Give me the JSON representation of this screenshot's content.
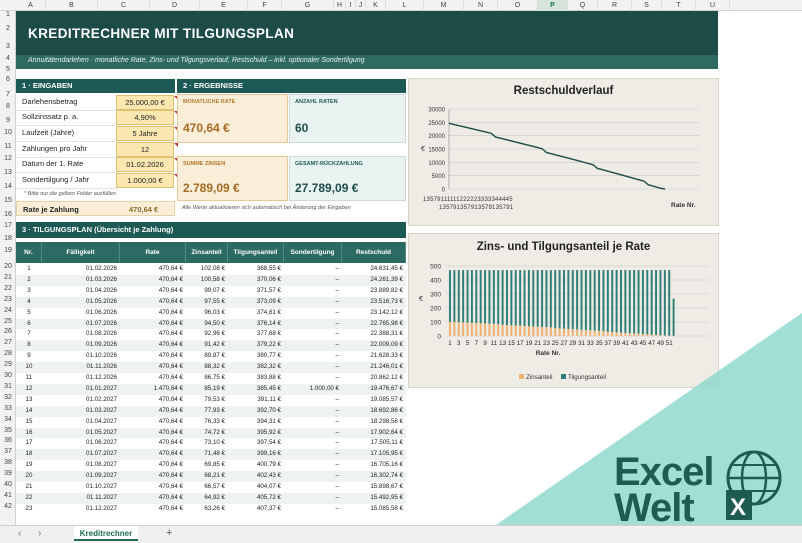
{
  "columns": [
    "A",
    "B",
    "C",
    "D",
    "E",
    "F",
    "G",
    "H",
    "I",
    "J",
    "K",
    "L",
    "M",
    "N",
    "O",
    "P",
    "Q",
    "R",
    "S",
    "T",
    "U"
  ],
  "selected_column": "P",
  "rows": [
    "1",
    "2",
    "3",
    "4",
    "5",
    "6",
    "7",
    "8",
    "9",
    "10",
    "11",
    "12",
    "13",
    "14",
    "15",
    "16",
    "17",
    "18",
    "19",
    "20",
    "21",
    "22",
    "23",
    "24",
    "25",
    "26",
    "27",
    "28",
    "29",
    "30",
    "31",
    "32",
    "33",
    "34",
    "35",
    "36",
    "37",
    "38",
    "39",
    "40",
    "41",
    "42"
  ],
  "title": "KREDITRECHNER  MIT  TILGUNGSPLAN",
  "subtitle": "Annuitätendarlehen · monatliche Rate, Zins- und Tilgungsverlauf, Restschuld – inkl. optionaler Sondertilgung",
  "inputs": {
    "header": "1 · EINGABEN",
    "rows": [
      {
        "label": "Darlehensbetrag",
        "value": "25.000,00 €"
      },
      {
        "label": "Sollzinssatz p. a.",
        "value": "4,90%"
      },
      {
        "label": "Laufzeit (Jahre)",
        "value": "5 Jahre"
      },
      {
        "label": "Zahlungen pro Jahr",
        "value": "12"
      },
      {
        "label": "Datum der 1. Rate",
        "value": "01.02.2026"
      },
      {
        "label": "Sondertilgung / Jahr",
        "value": "1.000,00 €"
      }
    ],
    "note": "* Bitte nur die gelben Felder ausfüllen.",
    "rate_label": "Rate je Zahlung",
    "rate_value": "470,64 €"
  },
  "results": {
    "header": "2 · ERGEBNISSE",
    "monthly_label": "MONATLICHE RATE",
    "monthly_value": "470,64 €",
    "count_label": "ANZAHL RATEN",
    "count_value": "60",
    "interest_label": "SUMME ZINSEN",
    "interest_value": "2.789,09 €",
    "total_label": "GESAMT-RÜCKZAHLUNG",
    "total_value": "27.789,09 €",
    "note": "Alle Werte aktualisieren sich automatisch bei Änderung der Eingaben"
  },
  "plan": {
    "header": "3 · TILGUNGSPLAN (Übersicht je Zahlung)",
    "columns": [
      "Nr.",
      "Fälligkeit",
      "Rate",
      "Zinsanteil",
      "Tilgungsanteil",
      "Sondertilgung",
      "Restschuld"
    ],
    "rows": [
      [
        "1",
        "01.02.2026",
        "470,64 €",
        "102,08 €",
        "368,55 €",
        "–",
        "24.631,45 €"
      ],
      [
        "2",
        "01.03.2026",
        "470,64 €",
        "100,58 €",
        "370,06 €",
        "–",
        "24.261,39 €"
      ],
      [
        "3",
        "01.04.2026",
        "470,64 €",
        "99,07 €",
        "371,57 €",
        "–",
        "23.889,82 €"
      ],
      [
        "4",
        "01.05.2026",
        "470,64 €",
        "97,55 €",
        "373,09 €",
        "–",
        "23.516,73 €"
      ],
      [
        "5",
        "01.06.2026",
        "470,64 €",
        "96,03 €",
        "374,61 €",
        "–",
        "23.142,12 €"
      ],
      [
        "6",
        "01.07.2026",
        "470,64 €",
        "94,50 €",
        "376,14 €",
        "–",
        "22.765,98 €"
      ],
      [
        "7",
        "01.08.2026",
        "470,64 €",
        "92,96 €",
        "377,68 €",
        "–",
        "22.388,31 €"
      ],
      [
        "8",
        "01.09.2026",
        "470,64 €",
        "91,42 €",
        "379,22 €",
        "–",
        "22.009,09 €"
      ],
      [
        "9",
        "01.10.2026",
        "470,64 €",
        "89,87 €",
        "380,77 €",
        "–",
        "21.628,33 €"
      ],
      [
        "10",
        "01.11.2026",
        "470,64 €",
        "88,32 €",
        "382,32 €",
        "–",
        "21.246,01 €"
      ],
      [
        "11",
        "01.12.2026",
        "470,64 €",
        "86,75 €",
        "383,88 €",
        "–",
        "20.862,12 €"
      ],
      [
        "12",
        "01.01.2027",
        "1.470,64 €",
        "85,19 €",
        "385,45 €",
        "1.000,00 €",
        "19.476,67 €"
      ],
      [
        "13",
        "01.02.2027",
        "470,64 €",
        "79,53 €",
        "391,11 €",
        "–",
        "19.085,57 €"
      ],
      [
        "14",
        "01.03.2027",
        "470,64 €",
        "77,93 €",
        "392,70 €",
        "–",
        "18.692,86 €"
      ],
      [
        "15",
        "01.04.2027",
        "470,64 €",
        "76,33 €",
        "394,31 €",
        "–",
        "18.298,56 €"
      ],
      [
        "16",
        "01.05.2027",
        "470,64 €",
        "74,72 €",
        "395,92 €",
        "–",
        "17.902,64 €"
      ],
      [
        "17",
        "01.06.2027",
        "470,64 €",
        "73,10 €",
        "397,54 €",
        "–",
        "17.505,11 €"
      ],
      [
        "18",
        "01.07.2027",
        "470,64 €",
        "71,48 €",
        "399,16 €",
        "–",
        "17.105,95 €"
      ],
      [
        "19",
        "01.08.2027",
        "470,64 €",
        "69,85 €",
        "400,79 €",
        "–",
        "16.705,16 €"
      ],
      [
        "20",
        "01.09.2027",
        "470,64 €",
        "68,21 €",
        "402,43 €",
        "–",
        "16.302,74 €"
      ],
      [
        "21",
        "01.10.2027",
        "470,64 €",
        "66,57 €",
        "404,07 €",
        "–",
        "15.898,67 €"
      ],
      [
        "22",
        "01.11.2027",
        "470,64 €",
        "64,92 €",
        "405,72 €",
        "–",
        "15.492,95 €"
      ],
      [
        "23",
        "01.12.2027",
        "470,64 €",
        "63,26 €",
        "407,37 €",
        "–",
        "15.085,58 €"
      ]
    ]
  },
  "chart_data": [
    {
      "type": "line",
      "title": "Restschuldverlauf",
      "xlabel": "Rate Nr.",
      "ylabel": "€",
      "ylim": [
        0,
        30000
      ],
      "yticks": [
        "30000",
        "25000",
        "20000",
        "15000",
        "10000",
        "5000",
        "0"
      ],
      "xtick_row1": "13579111111222223333344445",
      "xtick_row2": "135791357913579135791",
      "grid": true,
      "x": [
        1,
        3,
        5,
        7,
        9,
        11,
        12,
        13,
        15,
        17,
        19,
        21,
        23,
        24,
        25,
        27,
        29,
        31,
        33,
        35,
        36,
        37,
        39,
        41,
        43,
        45,
        47,
        48,
        49,
        51,
        52
      ],
      "y": [
        24631,
        23890,
        23142,
        22388,
        21628,
        20862,
        19477,
        19086,
        18299,
        17505,
        16705,
        15899,
        15086,
        13700,
        13293,
        12464,
        11629,
        10788,
        9940,
        9087,
        7760,
        7326,
        6462,
        5591,
        4714,
        3832,
        2944,
        1600,
        1160,
        267,
        0
      ]
    },
    {
      "type": "bar",
      "stacked": true,
      "title": "Zins- und Tilgungsanteil je Rate",
      "xlabel": "Rate Nr.",
      "ylabel": "€",
      "ylim": [
        0,
        500
      ],
      "yticks": [
        "500",
        "400",
        "300",
        "200",
        "100",
        "0"
      ],
      "xticks": [
        "1",
        "3",
        "5",
        "7",
        "9",
        "11",
        "13",
        "15",
        "17",
        "19",
        "21",
        "23",
        "25",
        "27",
        "29",
        "31",
        "33",
        "35",
        "37",
        "39",
        "41",
        "43",
        "45",
        "47",
        "49",
        "51"
      ],
      "legend": "bottom",
      "colors": {
        "Zinsanteil": "#f0b070",
        "Tilgungsanteil": "#2e7f7a"
      },
      "series": [
        {
          "name": "Zinsanteil",
          "values": [
            102,
            101,
            99,
            98,
            96,
            95,
            93,
            91,
            90,
            88,
            87,
            85,
            80,
            78,
            76,
            75,
            73,
            71,
            70,
            68,
            67,
            65,
            63,
            62,
            56,
            54,
            52,
            50,
            48,
            47,
            45,
            43,
            41,
            39,
            37,
            35,
            30,
            28,
            26,
            24,
            22,
            20,
            18,
            16,
            14,
            12,
            10,
            9,
            6,
            4,
            2,
            1
          ]
        },
        {
          "name": "Tilgungsanteil",
          "values": [
            369,
            370,
            372,
            373,
            375,
            376,
            378,
            379,
            381,
            382,
            384,
            385,
            391,
            393,
            394,
            396,
            398,
            399,
            401,
            402,
            404,
            406,
            407,
            409,
            415,
            417,
            419,
            421,
            423,
            424,
            426,
            428,
            430,
            432,
            434,
            436,
            441,
            443,
            445,
            447,
            449,
            451,
            453,
            455,
            457,
            459,
            461,
            462,
            465,
            467,
            469,
            266
          ]
        }
      ]
    }
  ],
  "sheet_tab": "Kreditrechner",
  "nav_prev": "‹",
  "nav_next": "›",
  "add_sheet": "+",
  "logo": {
    "line1": "Excel",
    "line2": "Welt",
    "badge": "X"
  }
}
